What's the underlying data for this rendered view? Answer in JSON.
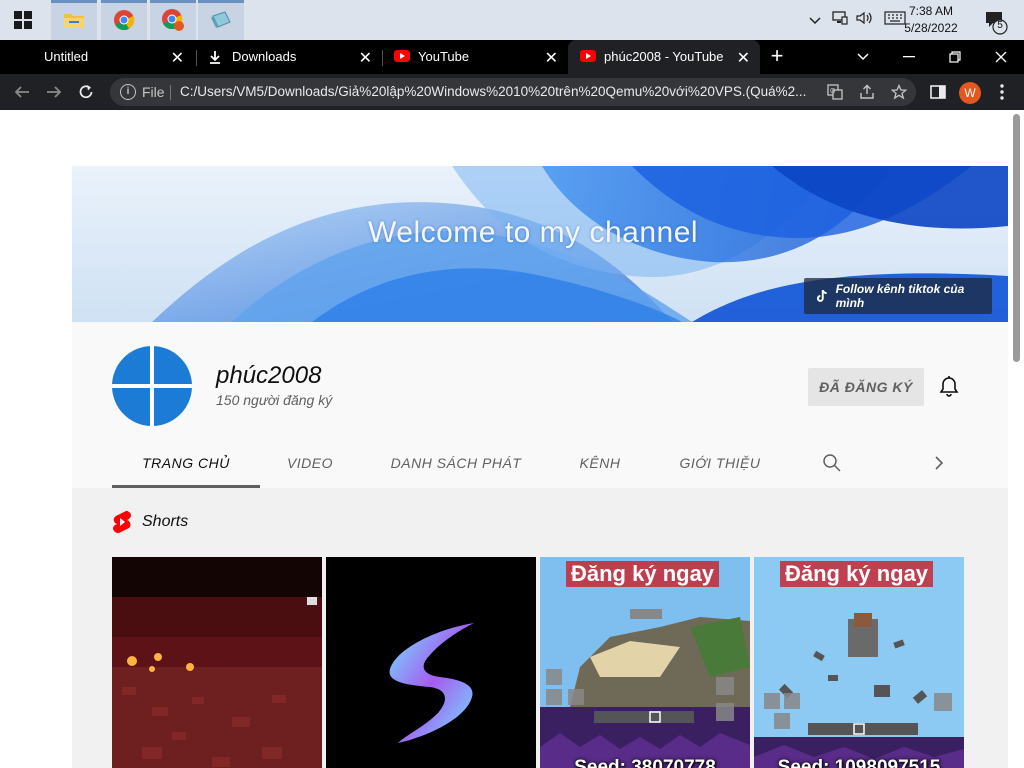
{
  "taskbar": {
    "apps": [
      "windows-start",
      "file-explorer",
      "chrome",
      "chrome-profile",
      "qemu-app"
    ],
    "clock": {
      "time": "7:38 AM",
      "date": "5/28/2022"
    },
    "notification_count": "5"
  },
  "browser": {
    "tabs": [
      {
        "title": "Untitled",
        "icon": "none"
      },
      {
        "title": "Downloads",
        "icon": "download-icon"
      },
      {
        "title": "YouTube",
        "icon": "youtube-icon"
      },
      {
        "title": "phúc2008 - YouTube",
        "icon": "youtube-icon",
        "active": true
      }
    ],
    "omnibox": {
      "scheme_label": "File",
      "url": "C:/Users/VM5/Downloads/Giả%20lập%20Windows%2010%20trên%20Qemu%20với%20VPS.(Quá%2..."
    },
    "profile_initial": "W"
  },
  "channel": {
    "banner_text": "Welcome to my channel",
    "banner_link": "Follow kênh tiktok của mình",
    "name": "phúc2008",
    "subscribers": "150 người đăng ký",
    "subscribe_button": "ĐÃ ĐĂNG KÝ",
    "tabs": [
      "TRANG CHỦ",
      "VIDEO",
      "DANH SÁCH PHÁT",
      "KÊNH",
      "GIỚI THIỆU"
    ],
    "shorts_title": "Shorts",
    "shorts": [
      {
        "kind": "nether-scene"
      },
      {
        "kind": "s-logo"
      },
      {
        "title": "Đăng ký ngay",
        "caption": "Seed: 38070778"
      },
      {
        "title": "Đăng ký ngay",
        "caption": "Seed: 1098097515"
      }
    ]
  },
  "colors": {
    "tabstrip": "#000000",
    "toolbar": "#202124",
    "avatar_blue": "#1c7cd5",
    "youtube_red": "#ff0000",
    "profile_orange": "#e2581f"
  }
}
